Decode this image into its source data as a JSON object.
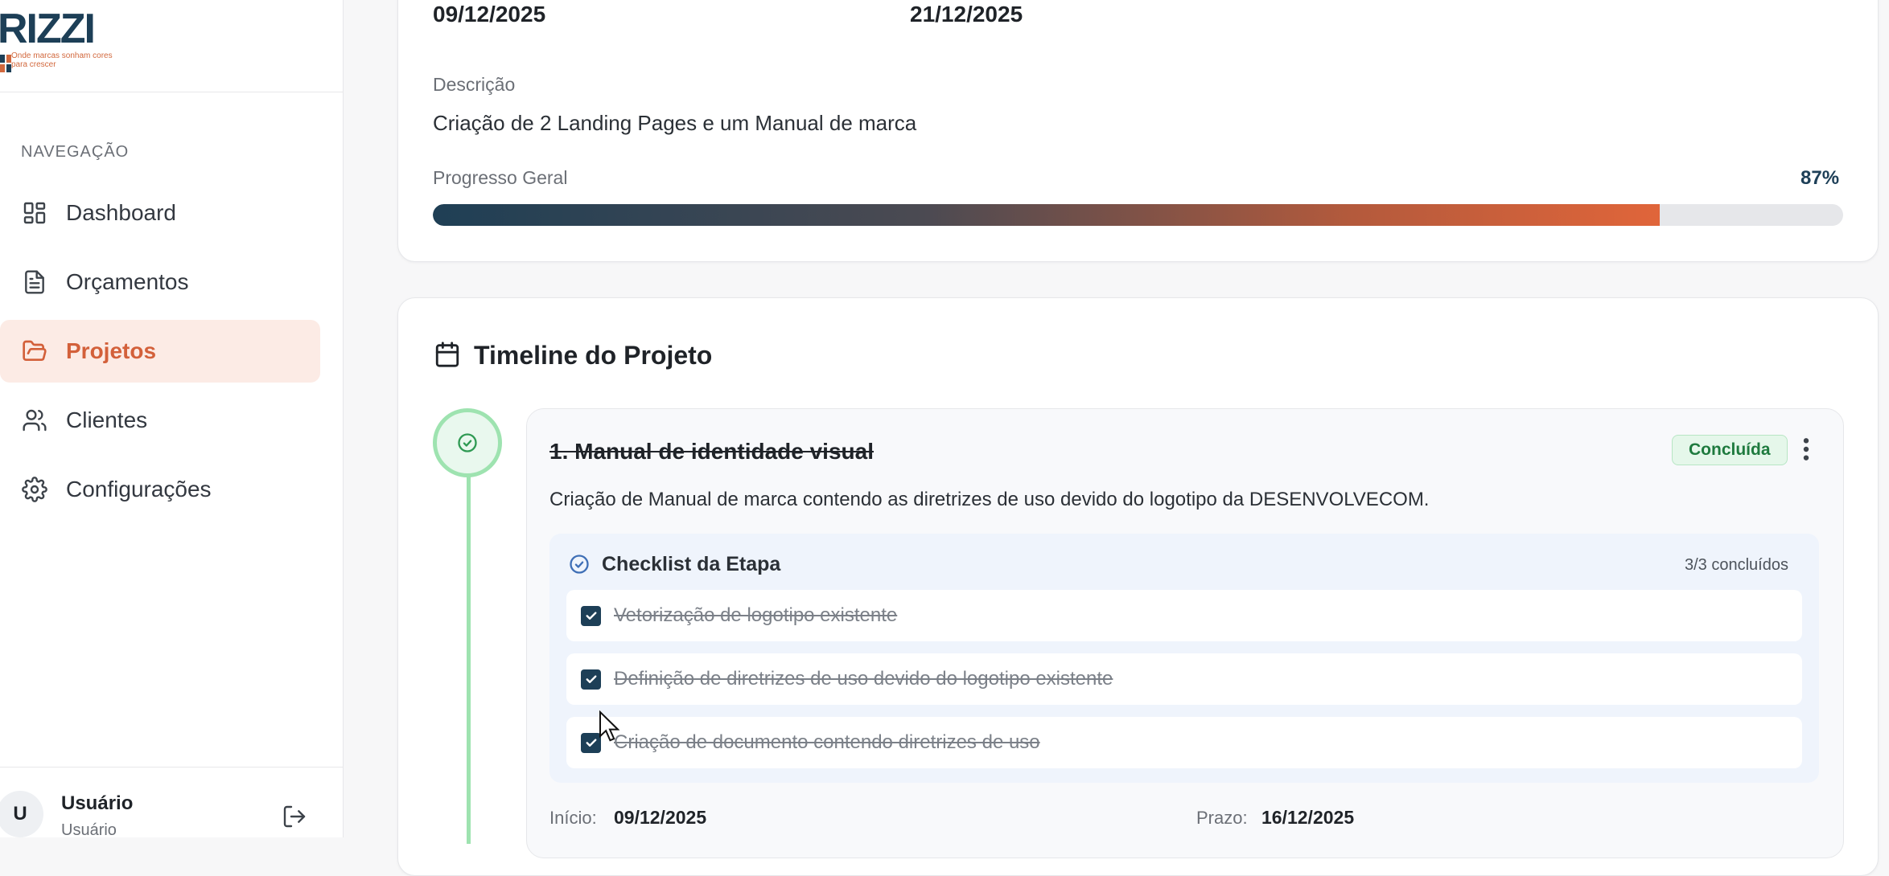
{
  "brand": {
    "logo_text": "RIZZI",
    "tagline": "Onde marcas sonham cores para crescer",
    "accent": "#d3603a",
    "navy": "#1d3f57"
  },
  "nav": {
    "heading": "NAVEGAÇÃO",
    "items": [
      {
        "label": "Dashboard",
        "icon": "dashboard-grid-icon"
      },
      {
        "label": "Orçamentos",
        "icon": "document-icon"
      },
      {
        "label": "Projetos",
        "icon": "folder-icon",
        "active": true
      },
      {
        "label": "Clientes",
        "icon": "users-icon"
      },
      {
        "label": "Configurações",
        "icon": "gear-icon"
      }
    ]
  },
  "user": {
    "initial": "U",
    "name": "Usuário",
    "role": "Usuário"
  },
  "project": {
    "start_date": "09/12/2025",
    "end_date": "21/12/2025",
    "description_label": "Descrição",
    "description": "Criação de 2 Landing Pages e um Manual de marca",
    "progress_label": "Progresso Geral",
    "progress_text": "87%",
    "progress_fraction": 0.87
  },
  "timeline": {
    "title": "Timeline do Projeto",
    "stages": [
      {
        "title": "1. Manual de identidade visual",
        "status": "Concluída",
        "description": "Criação de Manual de marca contendo as diretrizes de uso devido do logotipo da DESENVOLVECOM.",
        "checklist": {
          "title": "Checklist da Etapa",
          "count": "3/3 concluídos",
          "items": [
            "Vetorização de logotipo existente",
            "Definição de diretrizes de uso devido do logotipo existente",
            "Criação de documento contendo diretrizes de uso"
          ]
        },
        "start_label": "Início:",
        "start_date": "09/12/2025",
        "due_label": "Prazo:",
        "due_date": "16/12/2025"
      }
    ]
  }
}
